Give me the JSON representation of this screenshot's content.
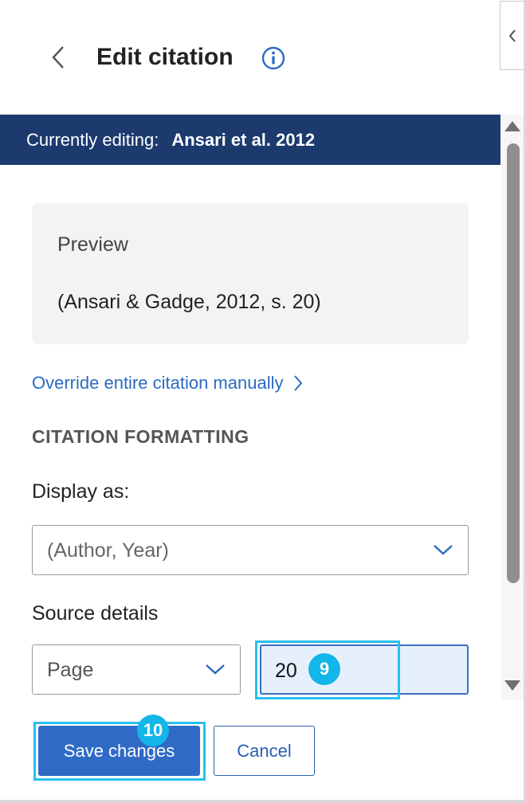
{
  "header": {
    "title": "Edit citation",
    "back_icon": "chevron-left-icon",
    "info_icon": "info-icon",
    "collapse_icon": "chevron-left-icon"
  },
  "editing_bar": {
    "label": "Currently editing:",
    "value": "Ansari et al. 2012"
  },
  "preview": {
    "label": "Preview",
    "text": "(Ansari & Gadge, 2012, s. 20)"
  },
  "override_link": {
    "label": "Override entire citation manually",
    "icon": "chevron-right-icon"
  },
  "formatting": {
    "heading": "CITATION FORMATTING",
    "display_as_label": "Display as:",
    "display_as_value": "(Author, Year)",
    "source_details_label": "Source details",
    "locator_type_value": "Page",
    "locator_value": "20"
  },
  "annotations": {
    "badge_input": "9",
    "badge_save": "10"
  },
  "actions": {
    "save_label": "Save changes",
    "cancel_label": "Cancel"
  },
  "colors": {
    "accent": "#2f6bc6",
    "editing_bar": "#1c3a6e",
    "link": "#2a6ac4",
    "highlight": "#27c0ee"
  }
}
